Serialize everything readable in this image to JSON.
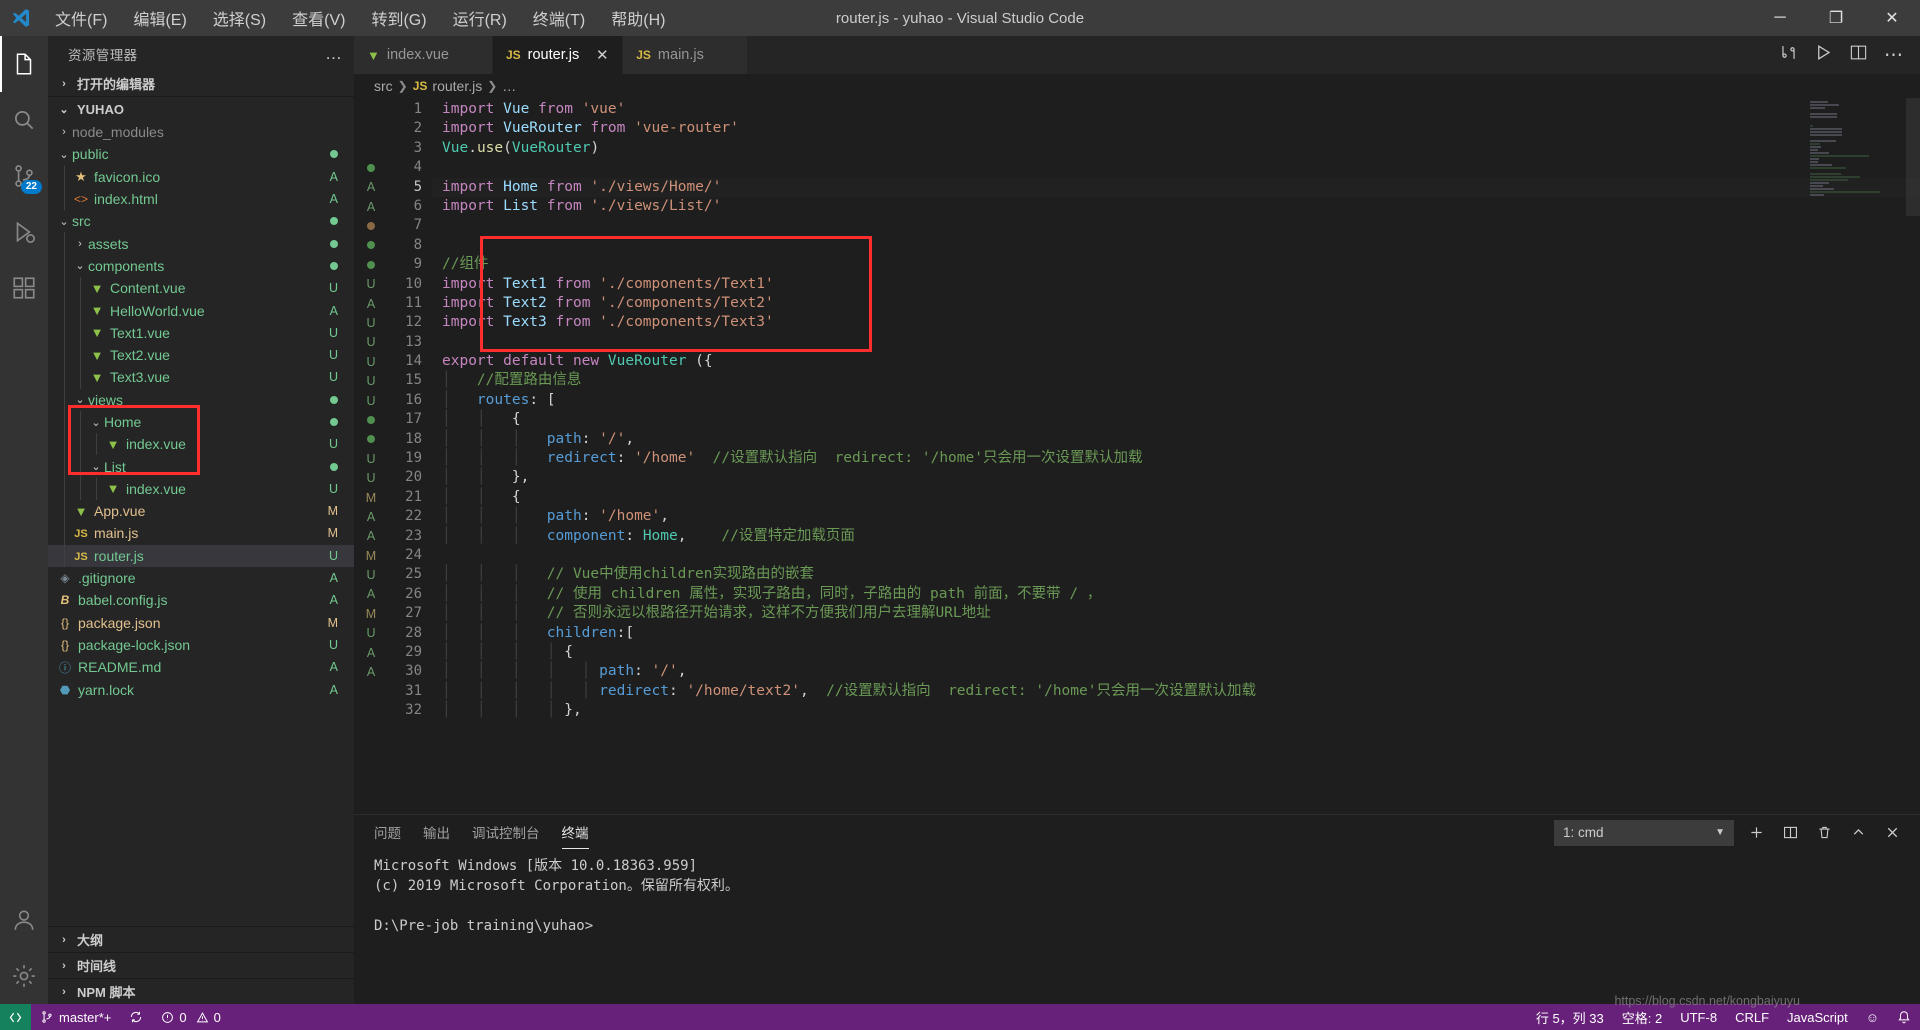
{
  "window": {
    "title": "router.js - yuhao - Visual Studio Code",
    "minimize_label": "─",
    "maximize_label": "❐",
    "close_label": "✕"
  },
  "menu": [
    {
      "label": "文件(F)"
    },
    {
      "label": "编辑(E)"
    },
    {
      "label": "选择(S)"
    },
    {
      "label": "查看(V)"
    },
    {
      "label": "转到(G)"
    },
    {
      "label": "运行(R)"
    },
    {
      "label": "终端(T)"
    },
    {
      "label": "帮助(H)"
    }
  ],
  "activitybar": {
    "items": [
      {
        "name": "explorer-icon",
        "active": true,
        "badge": ""
      },
      {
        "name": "search-icon",
        "active": false,
        "badge": ""
      },
      {
        "name": "source-control-icon",
        "active": false,
        "badge": "22"
      },
      {
        "name": "run-debug-icon",
        "active": false,
        "badge": ""
      },
      {
        "name": "extensions-icon",
        "active": false,
        "badge": ""
      }
    ],
    "bottom": [
      {
        "name": "accounts-icon"
      },
      {
        "name": "settings-gear-icon"
      }
    ]
  },
  "sidebar": {
    "header_title": "资源管理器",
    "header_more": "…",
    "open_editors_label": "打开的编辑器",
    "project_name": "YUHAO",
    "tree": [
      {
        "label": "node_modules",
        "indent": 1,
        "type": "folder",
        "expanded": false,
        "status": "",
        "icon": ""
      },
      {
        "label": "public",
        "indent": 1,
        "type": "folder",
        "expanded": true,
        "status": "dot-green",
        "icon": ""
      },
      {
        "label": "favicon.ico",
        "indent": 2,
        "type": "file",
        "status": "A",
        "icon": "star"
      },
      {
        "label": "index.html",
        "indent": 2,
        "type": "file",
        "status": "A",
        "icon": "html"
      },
      {
        "label": "src",
        "indent": 1,
        "type": "folder",
        "expanded": true,
        "status": "dot-green",
        "icon": ""
      },
      {
        "label": "assets",
        "indent": 2,
        "type": "folder",
        "expanded": false,
        "status": "dot-green",
        "icon": ""
      },
      {
        "label": "components",
        "indent": 2,
        "type": "folder",
        "expanded": true,
        "status": "dot-green",
        "icon": ""
      },
      {
        "label": "Content.vue",
        "indent": 3,
        "type": "file",
        "status": "U",
        "icon": "vue"
      },
      {
        "label": "HelloWorld.vue",
        "indent": 3,
        "type": "file",
        "status": "A",
        "icon": "vue"
      },
      {
        "label": "Text1.vue",
        "indent": 3,
        "type": "file",
        "status": "U",
        "icon": "vue"
      },
      {
        "label": "Text2.vue",
        "indent": 3,
        "type": "file",
        "status": "U",
        "icon": "vue"
      },
      {
        "label": "Text3.vue",
        "indent": 3,
        "type": "file",
        "status": "U",
        "icon": "vue"
      },
      {
        "label": "views",
        "indent": 2,
        "type": "folder",
        "expanded": true,
        "status": "dot-green",
        "icon": ""
      },
      {
        "label": "Home",
        "indent": 3,
        "type": "folder",
        "expanded": true,
        "status": "dot-green",
        "icon": ""
      },
      {
        "label": "index.vue",
        "indent": 4,
        "type": "file",
        "status": "U",
        "icon": "vue"
      },
      {
        "label": "List",
        "indent": 3,
        "type": "folder",
        "expanded": true,
        "status": "dot-green",
        "icon": ""
      },
      {
        "label": "index.vue",
        "indent": 4,
        "type": "file",
        "status": "U",
        "icon": "vue"
      },
      {
        "label": "App.vue",
        "indent": 2,
        "type": "file",
        "status": "M",
        "icon": "vue"
      },
      {
        "label": "main.js",
        "indent": 2,
        "type": "file",
        "status": "M",
        "icon": "js"
      },
      {
        "label": "router.js",
        "indent": 2,
        "type": "file",
        "status": "U",
        "icon": "js",
        "selected": true
      },
      {
        "label": ".gitignore",
        "indent": 1,
        "type": "file",
        "status": "A",
        "icon": "git"
      },
      {
        "label": "babel.config.js",
        "indent": 1,
        "type": "file",
        "status": "A",
        "icon": "babel"
      },
      {
        "label": "package.json",
        "indent": 1,
        "type": "file",
        "status": "M",
        "icon": "json"
      },
      {
        "label": "package-lock.json",
        "indent": 1,
        "type": "file",
        "status": "U",
        "icon": "json"
      },
      {
        "label": "README.md",
        "indent": 1,
        "type": "file",
        "status": "A",
        "icon": "info"
      },
      {
        "label": "yarn.lock",
        "indent": 1,
        "type": "file",
        "status": "A",
        "icon": "yarn"
      }
    ],
    "bottom_sections": [
      {
        "label": "大纲"
      },
      {
        "label": "时间线"
      },
      {
        "label": "NPM 脚本"
      }
    ]
  },
  "tabs": [
    {
      "label": "index.vue",
      "icon": "vue-icon",
      "active": false,
      "dirty": false
    },
    {
      "label": "router.js",
      "icon": "js-icon",
      "active": true,
      "dirty": false
    },
    {
      "label": "main.js",
      "icon": "js-icon",
      "active": false,
      "dirty": false
    }
  ],
  "tab_actions": [
    {
      "name": "split-compare-icon"
    },
    {
      "name": "run-play-icon"
    },
    {
      "name": "split-editor-icon"
    },
    {
      "name": "more-actions-icon"
    }
  ],
  "breadcrumbs": [
    {
      "label": "src"
    },
    {
      "label": "router.js",
      "icon": "js-icon"
    },
    {
      "label": "…"
    }
  ],
  "editor": {
    "first_line": 1,
    "gutter_markers": [
      "",
      "",
      "",
      "dot-green",
      "A",
      "A",
      "dot-orange",
      "dot-green",
      "dot-green",
      "U",
      "A",
      "U",
      "U",
      "U",
      "U",
      "U",
      "dot-green",
      "dot-green",
      "U",
      "U",
      "M",
      "A",
      "A",
      "M",
      "U",
      "A",
      "M",
      "U",
      "A",
      "A",
      "",
      ""
    ],
    "lines": [
      {
        "n": 1,
        "tokens": [
          [
            "kw",
            "import "
          ],
          [
            "id",
            "Vue"
          ],
          [
            "pn",
            " "
          ],
          [
            "kw",
            "from"
          ],
          [
            "pn",
            " "
          ],
          [
            "str",
            "'vue'"
          ]
        ]
      },
      {
        "n": 2,
        "tokens": [
          [
            "kw",
            "import "
          ],
          [
            "id",
            "VueRouter"
          ],
          [
            "pn",
            " "
          ],
          [
            "kw",
            "from"
          ],
          [
            "pn",
            " "
          ],
          [
            "str",
            "'vue-router'"
          ]
        ]
      },
      {
        "n": 3,
        "tokens": [
          [
            "ty",
            "Vue"
          ],
          [
            "pn",
            "."
          ],
          [
            "fn",
            "use"
          ],
          [
            "pn",
            "("
          ],
          [
            "ty",
            "VueRouter"
          ],
          [
            "pn",
            ")"
          ]
        ]
      },
      {
        "n": 4,
        "tokens": []
      },
      {
        "n": 5,
        "hl": true,
        "tokens": [
          [
            "kw",
            "import "
          ],
          [
            "id",
            "Home"
          ],
          [
            "pn",
            " "
          ],
          [
            "kw",
            "from"
          ],
          [
            "pn",
            " "
          ],
          [
            "str",
            "'./views/Home/'"
          ]
        ]
      },
      {
        "n": 6,
        "tokens": [
          [
            "kw",
            "import "
          ],
          [
            "id",
            "List"
          ],
          [
            "pn",
            " "
          ],
          [
            "kw",
            "from"
          ],
          [
            "pn",
            " "
          ],
          [
            "str",
            "'./views/List/'"
          ]
        ]
      },
      {
        "n": 7,
        "tokens": []
      },
      {
        "n": 8,
        "tokens": []
      },
      {
        "n": 9,
        "tokens": [
          [
            "cmt",
            "//组件"
          ]
        ]
      },
      {
        "n": 10,
        "tokens": [
          [
            "kw",
            "import "
          ],
          [
            "id",
            "Text1"
          ],
          [
            "pn",
            " "
          ],
          [
            "kw",
            "from"
          ],
          [
            "pn",
            " "
          ],
          [
            "str",
            "'./components/Text1'"
          ]
        ]
      },
      {
        "n": 11,
        "tokens": [
          [
            "kw",
            "import "
          ],
          [
            "id",
            "Text2"
          ],
          [
            "pn",
            " "
          ],
          [
            "kw",
            "from"
          ],
          [
            "pn",
            " "
          ],
          [
            "str",
            "'./components/Text2'"
          ]
        ]
      },
      {
        "n": 12,
        "tokens": [
          [
            "kw",
            "import "
          ],
          [
            "id",
            "Text3"
          ],
          [
            "pn",
            " "
          ],
          [
            "kw",
            "from"
          ],
          [
            "pn",
            " "
          ],
          [
            "str",
            "'./components/Text3'"
          ]
        ]
      },
      {
        "n": 13,
        "tokens": []
      },
      {
        "n": 14,
        "tokens": [
          [
            "kw",
            "export default "
          ],
          [
            "kw",
            "new "
          ],
          [
            "ty",
            "VueRouter"
          ],
          [
            "pn",
            " ({"
          ]
        ]
      },
      {
        "n": 15,
        "tokens": [
          [
            "indentguide",
            "│   "
          ],
          [
            "cmt",
            "//配置路由信息"
          ]
        ]
      },
      {
        "n": 16,
        "tokens": [
          [
            "indentguide",
            "│   "
          ],
          [
            "blu",
            "routes"
          ],
          [
            "pn",
            ": ["
          ]
        ]
      },
      {
        "n": 17,
        "tokens": [
          [
            "indentguide",
            "│   │   "
          ],
          [
            "pn",
            "{"
          ]
        ]
      },
      {
        "n": 18,
        "tokens": [
          [
            "indentguide",
            "│   │   │   "
          ],
          [
            "blu",
            "path"
          ],
          [
            "pn",
            ": "
          ],
          [
            "str",
            "'/'"
          ],
          [
            "pn",
            ","
          ]
        ]
      },
      {
        "n": 19,
        "tokens": [
          [
            "indentguide",
            "│   │   │   "
          ],
          [
            "blu",
            "redirect"
          ],
          [
            "pn",
            ": "
          ],
          [
            "str",
            "'/home'"
          ],
          [
            "pn",
            "  "
          ],
          [
            "cmt",
            "//设置默认指向  redirect: '/home'只会用一次设置默认加载"
          ]
        ]
      },
      {
        "n": 20,
        "tokens": [
          [
            "indentguide",
            "│   │   "
          ],
          [
            "pn",
            "},"
          ]
        ]
      },
      {
        "n": 21,
        "tokens": [
          [
            "indentguide",
            "│   │   "
          ],
          [
            "pn",
            "{"
          ]
        ]
      },
      {
        "n": 22,
        "tokens": [
          [
            "indentguide",
            "│   │   │   "
          ],
          [
            "blu",
            "path"
          ],
          [
            "pn",
            ": "
          ],
          [
            "str",
            "'/home'"
          ],
          [
            "pn",
            ","
          ]
        ]
      },
      {
        "n": 23,
        "tokens": [
          [
            "indentguide",
            "│   │   │   "
          ],
          [
            "blu",
            "component"
          ],
          [
            "pn",
            ": "
          ],
          [
            "ty",
            "Home"
          ],
          [
            "pn",
            ",    "
          ],
          [
            "cmt",
            "//设置特定加载页面"
          ]
        ]
      },
      {
        "n": 24,
        "tokens": []
      },
      {
        "n": 25,
        "tokens": [
          [
            "indentguide",
            "│   │   │   "
          ],
          [
            "cmt",
            "// Vue中使用children实现路由的嵌套"
          ]
        ]
      },
      {
        "n": 26,
        "tokens": [
          [
            "indentguide",
            "│   │   │   "
          ],
          [
            "cmt",
            "// 使用 children 属性，实现子路由，同时，子路由的 path 前面，不要带 / ，"
          ]
        ]
      },
      {
        "n": 27,
        "tokens": [
          [
            "indentguide",
            "│   │   │   "
          ],
          [
            "cmt",
            "// 否则永远以根路径开始请求，这样不方便我们用户去理解URL地址"
          ]
        ]
      },
      {
        "n": 28,
        "tokens": [
          [
            "indentguide",
            "│   │   │   "
          ],
          [
            "blu",
            "children"
          ],
          [
            "pn",
            ":["
          ]
        ]
      },
      {
        "n": 29,
        "tokens": [
          [
            "indentguide",
            "│   │   │   │ "
          ],
          [
            "pn",
            "{"
          ]
        ]
      },
      {
        "n": 30,
        "tokens": [
          [
            "indentguide",
            "│   │   │   │   │ "
          ],
          [
            "blu",
            "path"
          ],
          [
            "pn",
            ": "
          ],
          [
            "str",
            "'/'"
          ],
          [
            "pn",
            ","
          ]
        ]
      },
      {
        "n": 31,
        "tokens": [
          [
            "indentguide",
            "│   │   │   │   │ "
          ],
          [
            "blu",
            "redirect"
          ],
          [
            "pn",
            ": "
          ],
          [
            "str",
            "'/home/text2'"
          ],
          [
            "pn",
            ",  "
          ],
          [
            "cmt",
            "//设置默认指向  redirect: '/home'只会用一次设置默认加载"
          ]
        ]
      },
      {
        "n": 32,
        "tokens": [
          [
            "indentguide",
            "│   │   │   │ "
          ],
          [
            "pn",
            "},"
          ]
        ]
      }
    ],
    "annotations": [
      {
        "name": "highlight-box-imports",
        "color": "#ff2d2d"
      },
      {
        "name": "highlight-box-text-files",
        "color": "#ff2d2d"
      }
    ]
  },
  "panel": {
    "tabs": [
      {
        "label": "问题",
        "active": false
      },
      {
        "label": "输出",
        "active": false
      },
      {
        "label": "调试控制台",
        "active": false
      },
      {
        "label": "终端",
        "active": true
      }
    ],
    "terminal_select": "1: cmd",
    "actions": [
      {
        "name": "new-terminal-icon",
        "glyph": "+"
      },
      {
        "name": "split-terminal-icon",
        "glyph": "⬚"
      },
      {
        "name": "kill-terminal-icon",
        "glyph": "Ὕ1"
      },
      {
        "name": "maximize-panel-icon",
        "glyph": "⌃"
      },
      {
        "name": "close-panel-icon",
        "glyph": "✕"
      }
    ],
    "terminal_lines": [
      "Microsoft Windows [版本 10.0.18363.959]",
      "(c) 2019 Microsoft Corporation。保留所有权利。",
      "",
      "D:\\Pre-job training\\yuhao>"
    ]
  },
  "statusbar": {
    "remote_label": "",
    "branch": "master*+",
    "sync_label": "",
    "errors": "0",
    "warnings": "0",
    "cursor": "行 5，列 33",
    "spaces": "空格: 2",
    "encoding": "UTF-8",
    "eol": "CRLF",
    "language": "JavaScript",
    "feedback": "☺",
    "bell": "🔔"
  },
  "watermark": "https://blog.csdn.net/kongbaiyuyu"
}
